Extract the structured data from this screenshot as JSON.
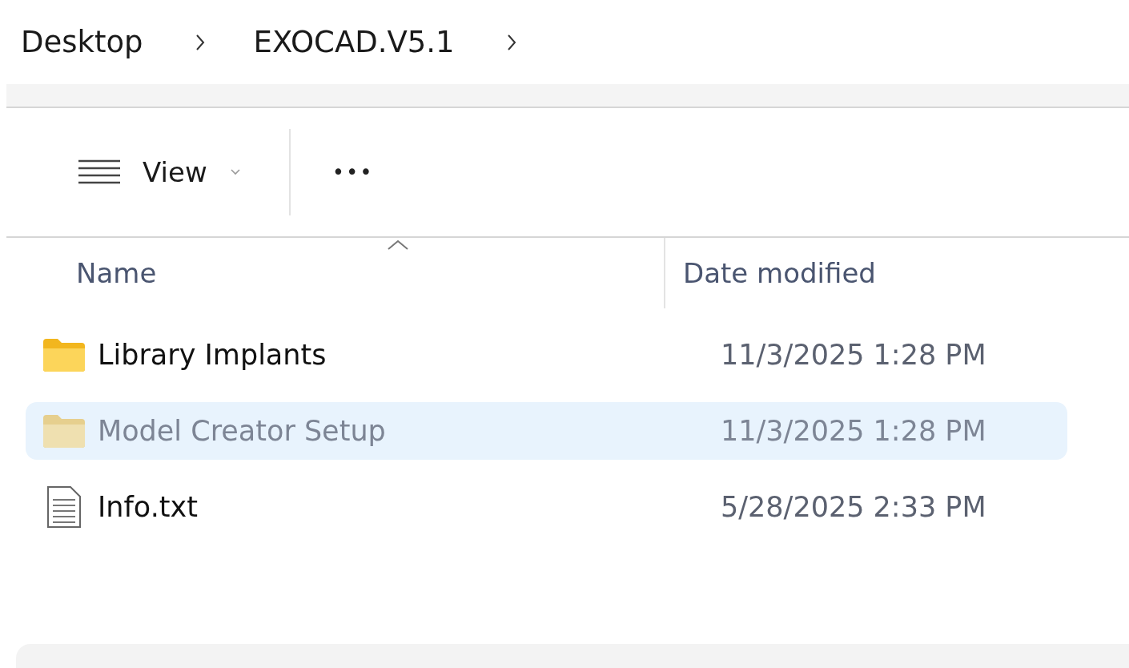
{
  "breadcrumb": [
    {
      "label": "Desktop"
    },
    {
      "label": "EXOCAD.V5.1"
    }
  ],
  "toolbar": {
    "view_label": "View",
    "more_label": "•••"
  },
  "columns": [
    {
      "label": "Name",
      "sorted": true
    },
    {
      "label": "Date modified",
      "sorted": false
    }
  ],
  "rows": [
    {
      "kind": "folder",
      "name": "Library Implants",
      "date": "11/3/2025 1:28 PM",
      "selected": false,
      "dimmed": false
    },
    {
      "kind": "folder",
      "name": "Model Creator Setup",
      "date": "11/3/2025 1:28 PM",
      "selected": true,
      "dimmed": true
    },
    {
      "kind": "file",
      "name": "Info.txt",
      "date": "5/28/2025 2:33 PM",
      "selected": false,
      "dimmed": false
    }
  ]
}
